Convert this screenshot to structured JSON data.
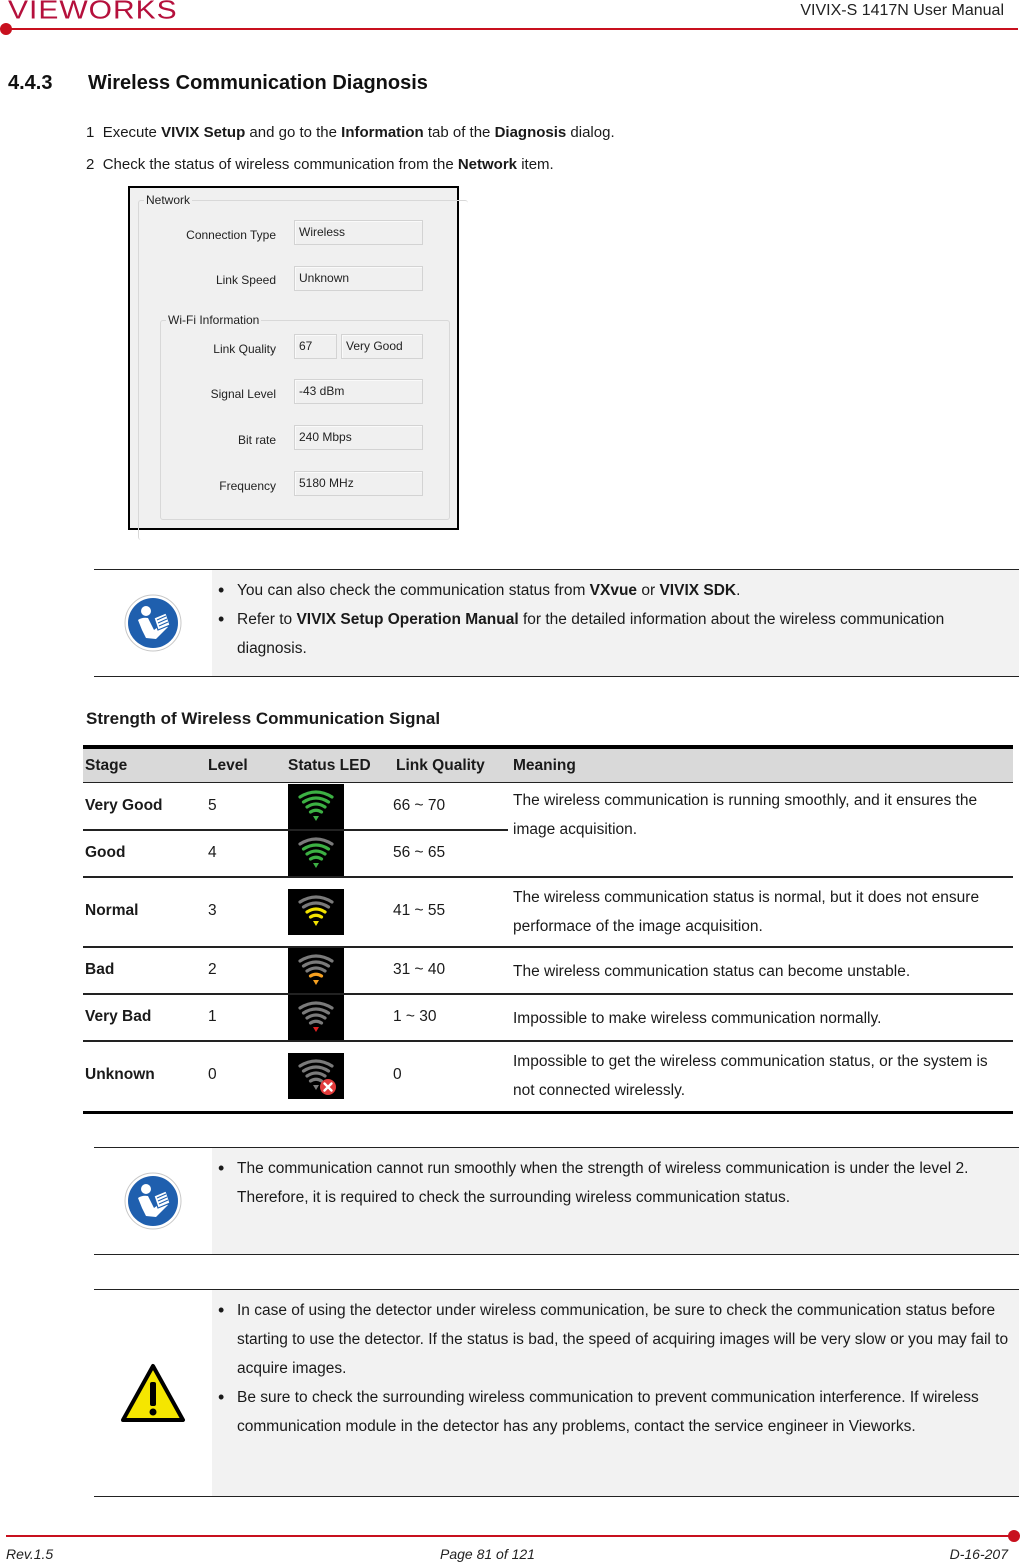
{
  "header": {
    "logo": "VIEWORKS",
    "doc_title": "VIVIX-S 1417N User Manual"
  },
  "section": {
    "number": "4.4.3",
    "title": "Wireless Communication Diagnosis"
  },
  "steps": [
    {
      "num": "1",
      "pre": "Execute ",
      "b1": "VIVIX Setup",
      "mid1": " and go to the ",
      "b2": "Information",
      "mid2": " tab of the ",
      "b3": "Diagnosis",
      "post": " dialog."
    },
    {
      "num": "2",
      "pre": "Check the status of wireless communication from the ",
      "b1": "Network",
      "post": " item."
    }
  ],
  "dialog": {
    "group_network": "Network",
    "group_wifi": "Wi-Fi Information",
    "fields": {
      "connection_type": {
        "label": "Connection Type",
        "value": "Wireless"
      },
      "link_speed": {
        "label": "Link Speed",
        "value": "Unknown"
      },
      "link_quality": {
        "label": "Link Quality",
        "value": "67",
        "rating": "Very Good"
      },
      "signal_level": {
        "label": "Signal Level",
        "value": "-43 dBm"
      },
      "bit_rate": {
        "label": "Bit rate",
        "value": "240 Mbps"
      },
      "frequency": {
        "label": "Frequency",
        "value": "5180 MHz"
      }
    }
  },
  "note1": {
    "icon": "read-manual-icon",
    "items": [
      {
        "pre": "You can also check the communication status from ",
        "b1": "VXvue",
        "mid": " or ",
        "b2": "VIVIX SDK",
        "post": "."
      },
      {
        "pre": "Refer to ",
        "b1": "VIVIX Setup Operation Manual",
        "post": " for the detailed information about the wireless communication diagnosis."
      }
    ]
  },
  "table": {
    "title": "Strength of Wireless Communication Signal",
    "headers": [
      "Stage",
      "Level",
      "Status LED",
      "Link Quality",
      "Meaning"
    ],
    "rows": [
      {
        "stage": "Very Good",
        "level": "5",
        "led_color": "#3cb043",
        "led_bars_lit": 4,
        "link_quality": "66 ~ 70",
        "meaning": "The wireless communication is running smoothly, and it ensures the image acquisition."
      },
      {
        "stage": "Good",
        "level": "4",
        "led_color": "#3cb043",
        "led_bars_lit": 3,
        "link_quality": "56 ~ 65",
        "meaning": ""
      },
      {
        "stage": "Normal",
        "level": "3",
        "led_color": "#f2e200",
        "led_bars_lit": 2,
        "link_quality": "41 ~ 55",
        "meaning": "The wireless communication status is normal, but it does not ensure performace of the image acquisition."
      },
      {
        "stage": "Bad",
        "level": "2",
        "led_color": "#f5a020",
        "led_bars_lit": 1,
        "link_quality": "31 ~ 40",
        "meaning": "The wireless communication status can become unstable."
      },
      {
        "stage": "Very Bad",
        "level": "1",
        "led_color": "#e02020",
        "led_bars_lit": 0,
        "link_quality": "1 ~ 30",
        "meaning": "Impossible to make wireless communication normally."
      },
      {
        "stage": "Unknown",
        "level": "0",
        "led_color": "#e23b3b",
        "led_bars_lit": -1,
        "link_quality": "0",
        "meaning": "Impossible to get the wireless communication status, or the system is not connected wirelessly."
      }
    ]
  },
  "note2": {
    "icon": "read-manual-icon",
    "items": [
      {
        "text": "The communication cannot run smoothly when the strength of wireless communication is under the level 2. Therefore, it is required to check the surrounding wireless communication status."
      }
    ]
  },
  "note3": {
    "icon": "warning-icon",
    "items": [
      {
        "text": "In case of using the detector under wireless communication, be sure to check the communication status before starting to use the detector. If the status is bad, the speed of acquiring images will be very slow or you may fail to acquire images."
      },
      {
        "text": "Be sure to check the surrounding wireless communication to prevent communication interference. If wireless communication module in the detector has any problems, contact the service engineer in Vieworks."
      }
    ]
  },
  "footer": {
    "revision": "Rev.1.5",
    "page": "Page 81 of 121",
    "doc_id": "D-16-207"
  }
}
